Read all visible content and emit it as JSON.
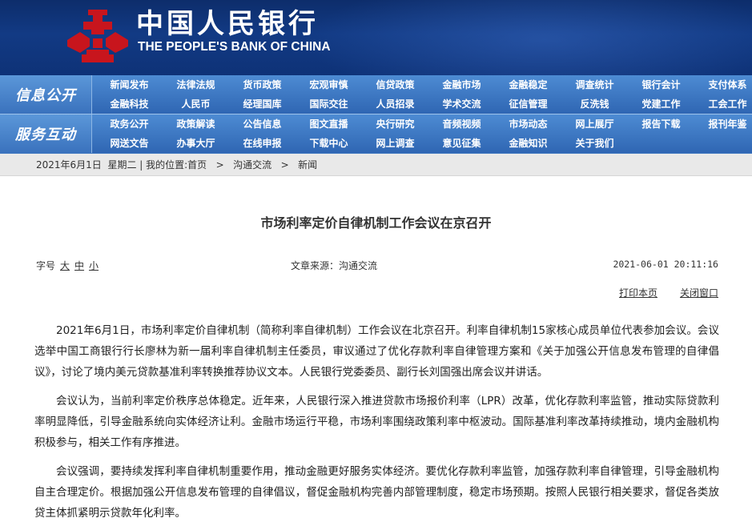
{
  "header": {
    "logo_cn": "中国人民银行",
    "logo_en": "THE PEOPLE'S BANK OF CHINA",
    "brand_color": "#c8151d"
  },
  "nav": {
    "section1": {
      "label": "信息公开",
      "row1": [
        "新闻发布",
        "法律法规",
        "货币政策",
        "宏观审慎",
        "信贷政策",
        "金融市场",
        "金融稳定",
        "调查统计",
        "银行会计",
        "支付体系"
      ],
      "row2": [
        "金融科技",
        "人民币",
        "经理国库",
        "国际交往",
        "人员招录",
        "学术交流",
        "征信管理",
        "反洗钱",
        "党建工作",
        "工会工作"
      ]
    },
    "section2": {
      "label": "服务互动",
      "row1": [
        "政务公开",
        "政策解读",
        "公告信息",
        "图文直播",
        "央行研究",
        "音频视频",
        "市场动态",
        "网上展厅",
        "报告下载",
        "报刊年鉴"
      ],
      "row2": [
        "网送文告",
        "办事大厅",
        "在线申报",
        "下载中心",
        "网上调查",
        "意见征集",
        "金融知识",
        "关于我们"
      ]
    }
  },
  "breadcrumb": {
    "date": "2021年6月1日  星期二",
    "location_label": "我的位置:",
    "home": "首页",
    "level1": "沟通交流",
    "level2": "新闻"
  },
  "article": {
    "title": "市场利率定价自律机制工作会议在京召开",
    "font_size_label": "字号",
    "font_sizes": [
      "大",
      "中",
      "小"
    ],
    "source": "文章来源：沟通交流",
    "date": "2021-06-01 20:11:16",
    "print_label": "打印本页",
    "close_label": "关闭窗口",
    "paragraphs": [
      "2021年6月1日，市场利率定价自律机制（简称利率自律机制）工作会议在北京召开。利率自律机制15家核心成员单位代表参加会议。会议选举中国工商银行行长廖林为新一届利率自律机制主任委员，审议通过了优化存款利率自律管理方案和《关于加强公开信息发布管理的自律倡议》，讨论了境内美元贷款基准利率转换推荐协议文本。人民银行党委委员、副行长刘国强出席会议并讲话。",
      "会议认为，当前利率定价秩序总体稳定。近年来，人民银行深入推进贷款市场报价利率（LPR）改革，优化存款利率监管，推动实际贷款利率明显降低，引导金融系统向实体经济让利。金融市场运行平稳，市场利率围绕政策利率中枢波动。国际基准利率改革持续推动，境内金融机构积极参与，相关工作有序推进。",
      "会议强调，要持续发挥利率自律机制重要作用，推动金融更好服务实体经济。要优化存款利率监管，加强存款利率自律管理，引导金融机构自主合理定价。根据加强公开信息发布管理的自律倡议，督促金融机构完善内部管理制度，稳定市场预期。按照人民银行相关要求，督促各类放贷主体抓紧明示贷款年化利率。"
    ]
  }
}
